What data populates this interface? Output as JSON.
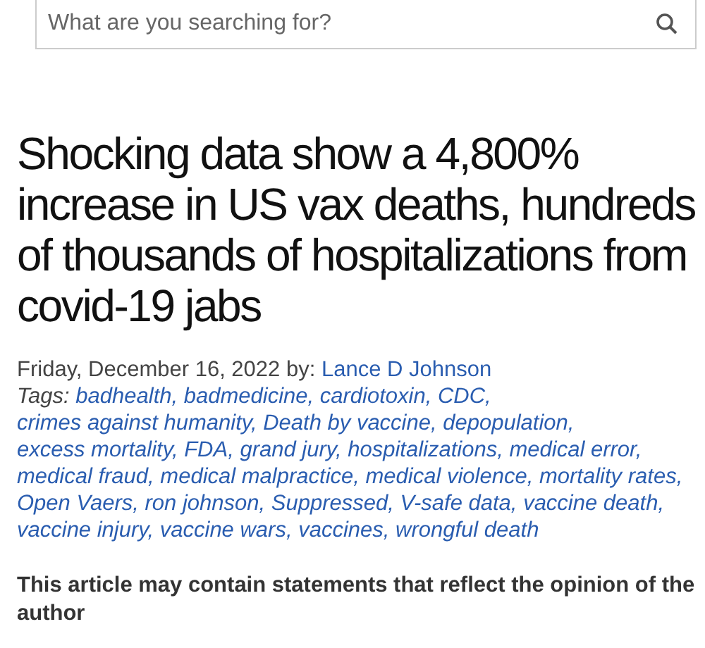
{
  "search": {
    "placeholder": "What are you searching for?"
  },
  "headline": "Shocking data show a 4,800% increase in US vax deaths, hundreds of thousands of hospitalizations from covid-19 jabs",
  "byline": {
    "date": "Friday, December 16, 2022 by:",
    "author": "Lance D Johnson"
  },
  "tags": {
    "label": "Tags:",
    "items": [
      "badhealth,",
      "badmedicine,",
      "cardiotoxin,",
      "CDC,",
      "crimes against humanity,",
      "Death by vaccine,",
      "depopulation,",
      "excess mortality,",
      "FDA,",
      "grand jury,",
      "hospitalizations,",
      "medical error,",
      "medical fraud,",
      "medical malpractice,",
      "medical violence,",
      "mortality rates,",
      "Open Vaers,",
      "ron johnson,",
      "Suppressed,",
      "V-safe data,",
      "vaccine death,",
      "vaccine injury,",
      "vaccine wars,",
      "vaccines,",
      "wrongful death"
    ]
  },
  "notice": "This article may contain statements that reflect the opinion of the author"
}
